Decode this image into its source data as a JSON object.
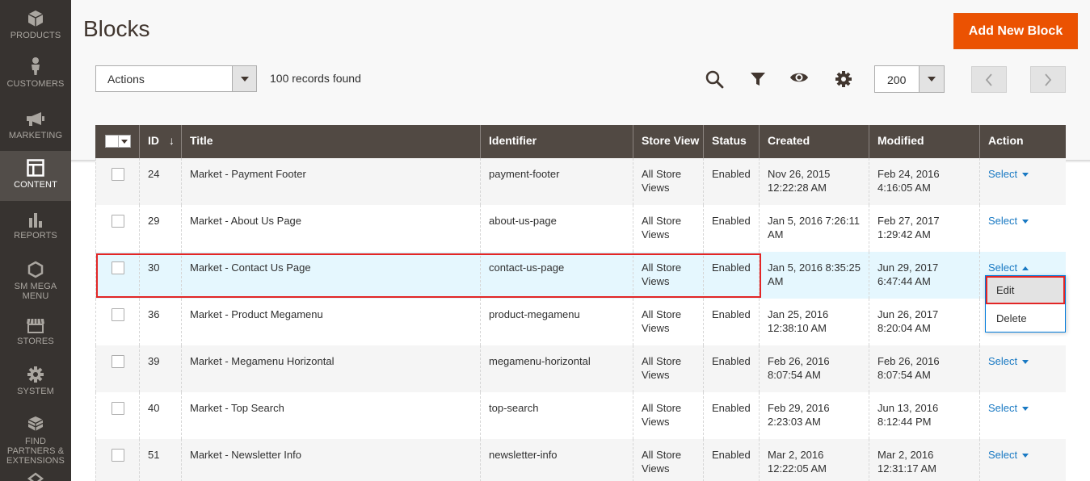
{
  "sidebar": {
    "items": [
      {
        "label": "PRODUCTS",
        "icon": "cube-icon"
      },
      {
        "label": "CUSTOMERS",
        "icon": "person-icon"
      },
      {
        "label": "MARKETING",
        "icon": "megaphone-icon"
      },
      {
        "label": "CONTENT",
        "icon": "layout-icon"
      },
      {
        "label": "REPORTS",
        "icon": "bar-chart-icon"
      },
      {
        "label": "SM MEGA MENU",
        "icon": "hexagon-icon"
      },
      {
        "label": "STORES",
        "icon": "storefront-icon"
      },
      {
        "label": "SYSTEM",
        "icon": "gear-icon"
      },
      {
        "label": "FIND PARTNERS & EXTENSIONS",
        "icon": "cubes-icon"
      }
    ]
  },
  "header": {
    "title": "Blocks",
    "add_button": "Add New Block"
  },
  "toolbar": {
    "actions_label": "Actions",
    "records_found": "100 records found",
    "per_page": "200"
  },
  "grid": {
    "columns": [
      "ID",
      "Title",
      "Identifier",
      "Store View",
      "Status",
      "Created",
      "Modified",
      "Action"
    ],
    "sort_indicator": "↓",
    "rows": [
      {
        "id": "24",
        "title": "Market - Payment Footer",
        "identifier": "payment-footer",
        "store": "All Store Views",
        "status": "Enabled",
        "created": "Nov 26, 2015 12:22:28 AM",
        "modified": "Feb 24, 2016 4:16:05 AM",
        "action": "Select"
      },
      {
        "id": "29",
        "title": "Market - About Us Page",
        "identifier": "about-us-page",
        "store": "All Store Views",
        "status": "Enabled",
        "created": "Jan 5, 2016 7:26:11 AM",
        "modified": "Feb 27, 2017 1:29:42 AM",
        "action": "Select"
      },
      {
        "id": "30",
        "title": "Market - Contact Us Page",
        "identifier": "contact-us-page",
        "store": "All Store Views",
        "status": "Enabled",
        "created": "Jan 5, 2016 8:35:25 AM",
        "modified": "Jun 29, 2017 6:47:44 AM",
        "action": "Select"
      },
      {
        "id": "36",
        "title": "Market - Product Megamenu",
        "identifier": "product-megamenu",
        "store": "All Store Views",
        "status": "Enabled",
        "created": "Jan 25, 2016 12:38:10 AM",
        "modified": "Jun 26, 2017 8:20:04 AM",
        "action": ""
      },
      {
        "id": "39",
        "title": "Market - Megamenu Horizontal",
        "identifier": "megamenu-horizontal",
        "store": "All Store Views",
        "status": "Enabled",
        "created": "Feb 26, 2016 8:07:54 AM",
        "modified": "Feb 26, 2016 8:07:54 AM",
        "action": "Select"
      },
      {
        "id": "40",
        "title": "Market - Top Search",
        "identifier": "top-search",
        "store": "All Store Views",
        "status": "Enabled",
        "created": "Feb 29, 2016 2:23:03 AM",
        "modified": "Jun 13, 2016 8:12:44 PM",
        "action": "Select"
      },
      {
        "id": "51",
        "title": "Market - Newsletter Info",
        "identifier": "newsletter-info",
        "store": "All Store Views",
        "status": "Enabled",
        "created": "Mar 2, 2016 12:22:05 AM",
        "modified": "Mar 2, 2016 12:31:17 AM",
        "action": "Select"
      }
    ]
  },
  "dropdown": {
    "edit": "Edit",
    "delete": "Delete"
  },
  "colors": {
    "accent": "#eb5202",
    "sidebar": "#373330",
    "grid_header": "#514943",
    "link": "#1979c3",
    "highlight": "#e22626"
  }
}
